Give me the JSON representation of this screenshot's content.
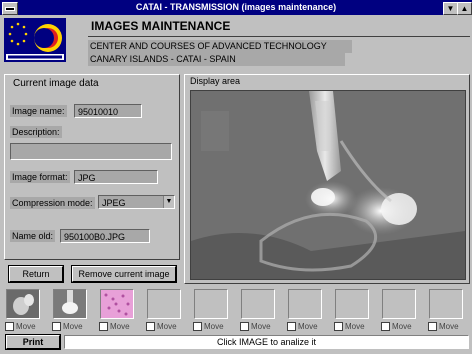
{
  "window": {
    "title": "CATAI - TRANSMISSION (images maintenance)",
    "minimize_label": "▼",
    "maximize_label": "▲"
  },
  "header": {
    "title": "IMAGES MAINTENANCE",
    "line1": "CENTER AND COURSES OF ADVANCED TECHNOLOGY",
    "line2": "CANARY ISLANDS - CATAI - SPAIN",
    "logo_text": "CATAI"
  },
  "form": {
    "panel_title": "Current image data",
    "image_name_label": "Image name:",
    "image_name_value": "95010010",
    "description_label": "Description:",
    "description_value": "",
    "image_format_label": "Image format:",
    "image_format_value": "JPG",
    "compression_label": "Compression mode:",
    "compression_value": "JPEG",
    "name_old_label": "Name old:",
    "name_old_value": "950100B0.JPG"
  },
  "display": {
    "label": "Display area"
  },
  "buttons": {
    "return_label": "Return",
    "remove_label": "Remove current image",
    "print_label": "Print"
  },
  "thumbnails": {
    "move_label": "Move",
    "slots": [
      {
        "state": "xray-dark"
      },
      {
        "state": "xray-bright"
      },
      {
        "state": "pink"
      },
      {
        "state": "empty"
      },
      {
        "state": "empty"
      },
      {
        "state": "empty"
      },
      {
        "state": "empty"
      },
      {
        "state": "empty"
      },
      {
        "state": "empty"
      },
      {
        "state": "empty"
      }
    ]
  },
  "status": {
    "text": "Click IMAGE to analize it"
  },
  "colors": {
    "titlebar": "#000080",
    "face": "#c0c0c0",
    "field": "#a8a8a8"
  }
}
